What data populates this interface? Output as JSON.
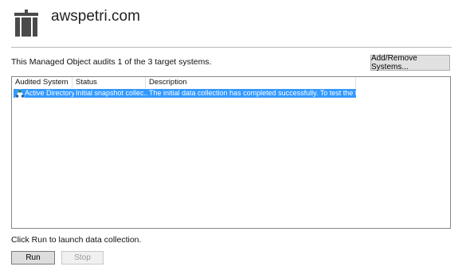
{
  "header": {
    "title": "awspetri.com",
    "logo_icon": "building-icon"
  },
  "audit": {
    "summary": "This Managed Object audits 1 of the 3 target systems.",
    "add_remove_label": "Add/Remove Systems..."
  },
  "table": {
    "columns": [
      "Audited System",
      "Status",
      "Description"
    ],
    "rows": [
      {
        "icon": "active-directory-icon",
        "system": "Active Directory",
        "status": "Initial snapshot collec...",
        "description": "The initial data collection has completed successfully. To test the functi...",
        "selected": true
      }
    ]
  },
  "footer": {
    "hint": "Click Run to launch data collection.",
    "run_label": "Run",
    "stop_label": "Stop"
  },
  "colors": {
    "selection": "#3399ff",
    "logo": "#4a4a4a"
  }
}
